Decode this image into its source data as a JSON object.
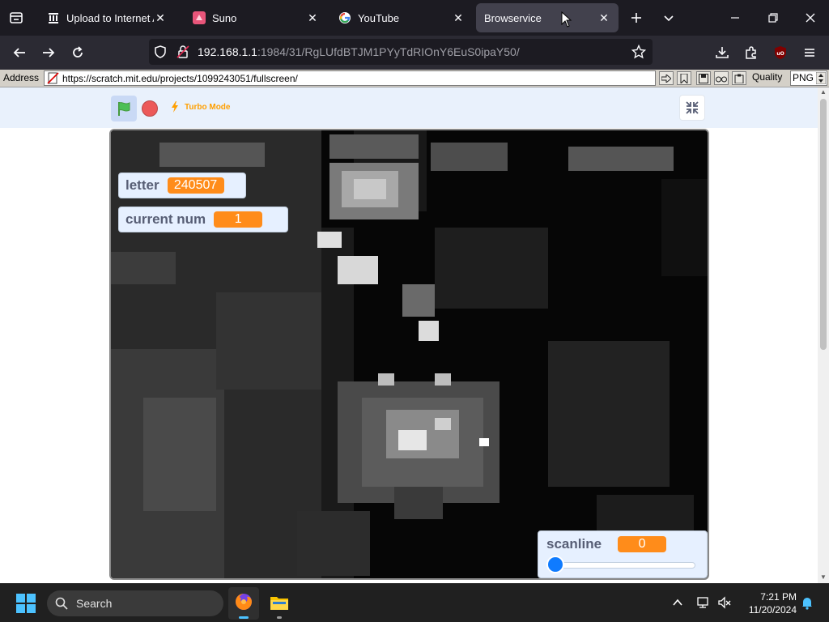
{
  "browser": {
    "tabs": [
      {
        "title": "Upload to Internet Arc",
        "icon": "archive-icon",
        "active": false
      },
      {
        "title": "Suno",
        "icon": "suno-icon",
        "active": false
      },
      {
        "title": "YouTube",
        "icon": "google-icon",
        "active": false
      },
      {
        "title": "Browservice",
        "icon": "blank-icon",
        "active": true
      }
    ],
    "url_host": "192.168.1.1",
    "url_rest": ":1984/31/RgLUfdBTJM1PYyTdRIOnY6EuS0ipaY50/"
  },
  "remote": {
    "address_label": "Address",
    "address_url": "https://scratch.mit.edu/projects/1099243051/fullscreen/",
    "quality_label": "Quality",
    "quality_value": "PNG"
  },
  "scratch": {
    "turbo_label": "Turbo Mode",
    "monitors": {
      "letter": {
        "label": "letter",
        "value": "240507"
      },
      "current_num": {
        "label": "current num",
        "value": "1"
      },
      "scanline": {
        "label": "scanline",
        "value": "0",
        "slider_fraction": 0
      }
    }
  },
  "taskbar": {
    "search_placeholder": "Search",
    "time": "7:21 PM",
    "date": "11/20/2024"
  },
  "colors": {
    "accent_orange": "#ff8c1a",
    "slider_blue": "#0f7bff",
    "flag_green": "#4cbf56"
  }
}
